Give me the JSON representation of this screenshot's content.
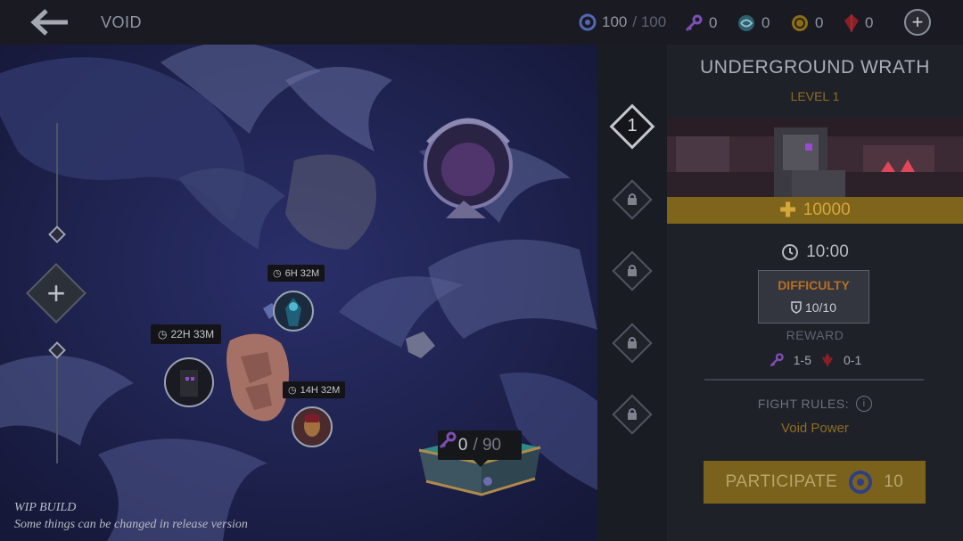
{
  "header": {
    "title": "VOID",
    "energy_current": "100",
    "energy_max": "/ 100",
    "keys": "0",
    "orbs": "0",
    "coins": "0",
    "gems": "0"
  },
  "map": {
    "timers": [
      "6H 32M",
      "22H 33M",
      "14H 32M"
    ],
    "key_progress_current": "0",
    "key_progress_max": "/ 90",
    "wip_line1": "WIP BUILD",
    "wip_line2": "Some things can be changed in release version"
  },
  "levels": {
    "active_number": "1"
  },
  "panel": {
    "title": "UNDERGROUND WRATH",
    "level": "LEVEL 1",
    "cost": "10000",
    "time": "10:00",
    "difficulty_label": "DIFFICULTY",
    "difficulty_value": "10/10",
    "reward_label": "REWARD",
    "reward_keys": "1-5",
    "reward_shards": "0-1",
    "fight_rules_label": "FIGHT RULES:",
    "fight_rules_value": "Void Power",
    "participate_label": "PARTICIPATE",
    "participate_cost": "10"
  },
  "colors": {
    "accent_gold": "#8c6d22",
    "difficulty_orange": "#b86f22",
    "map_purple": "#1b1f45"
  }
}
